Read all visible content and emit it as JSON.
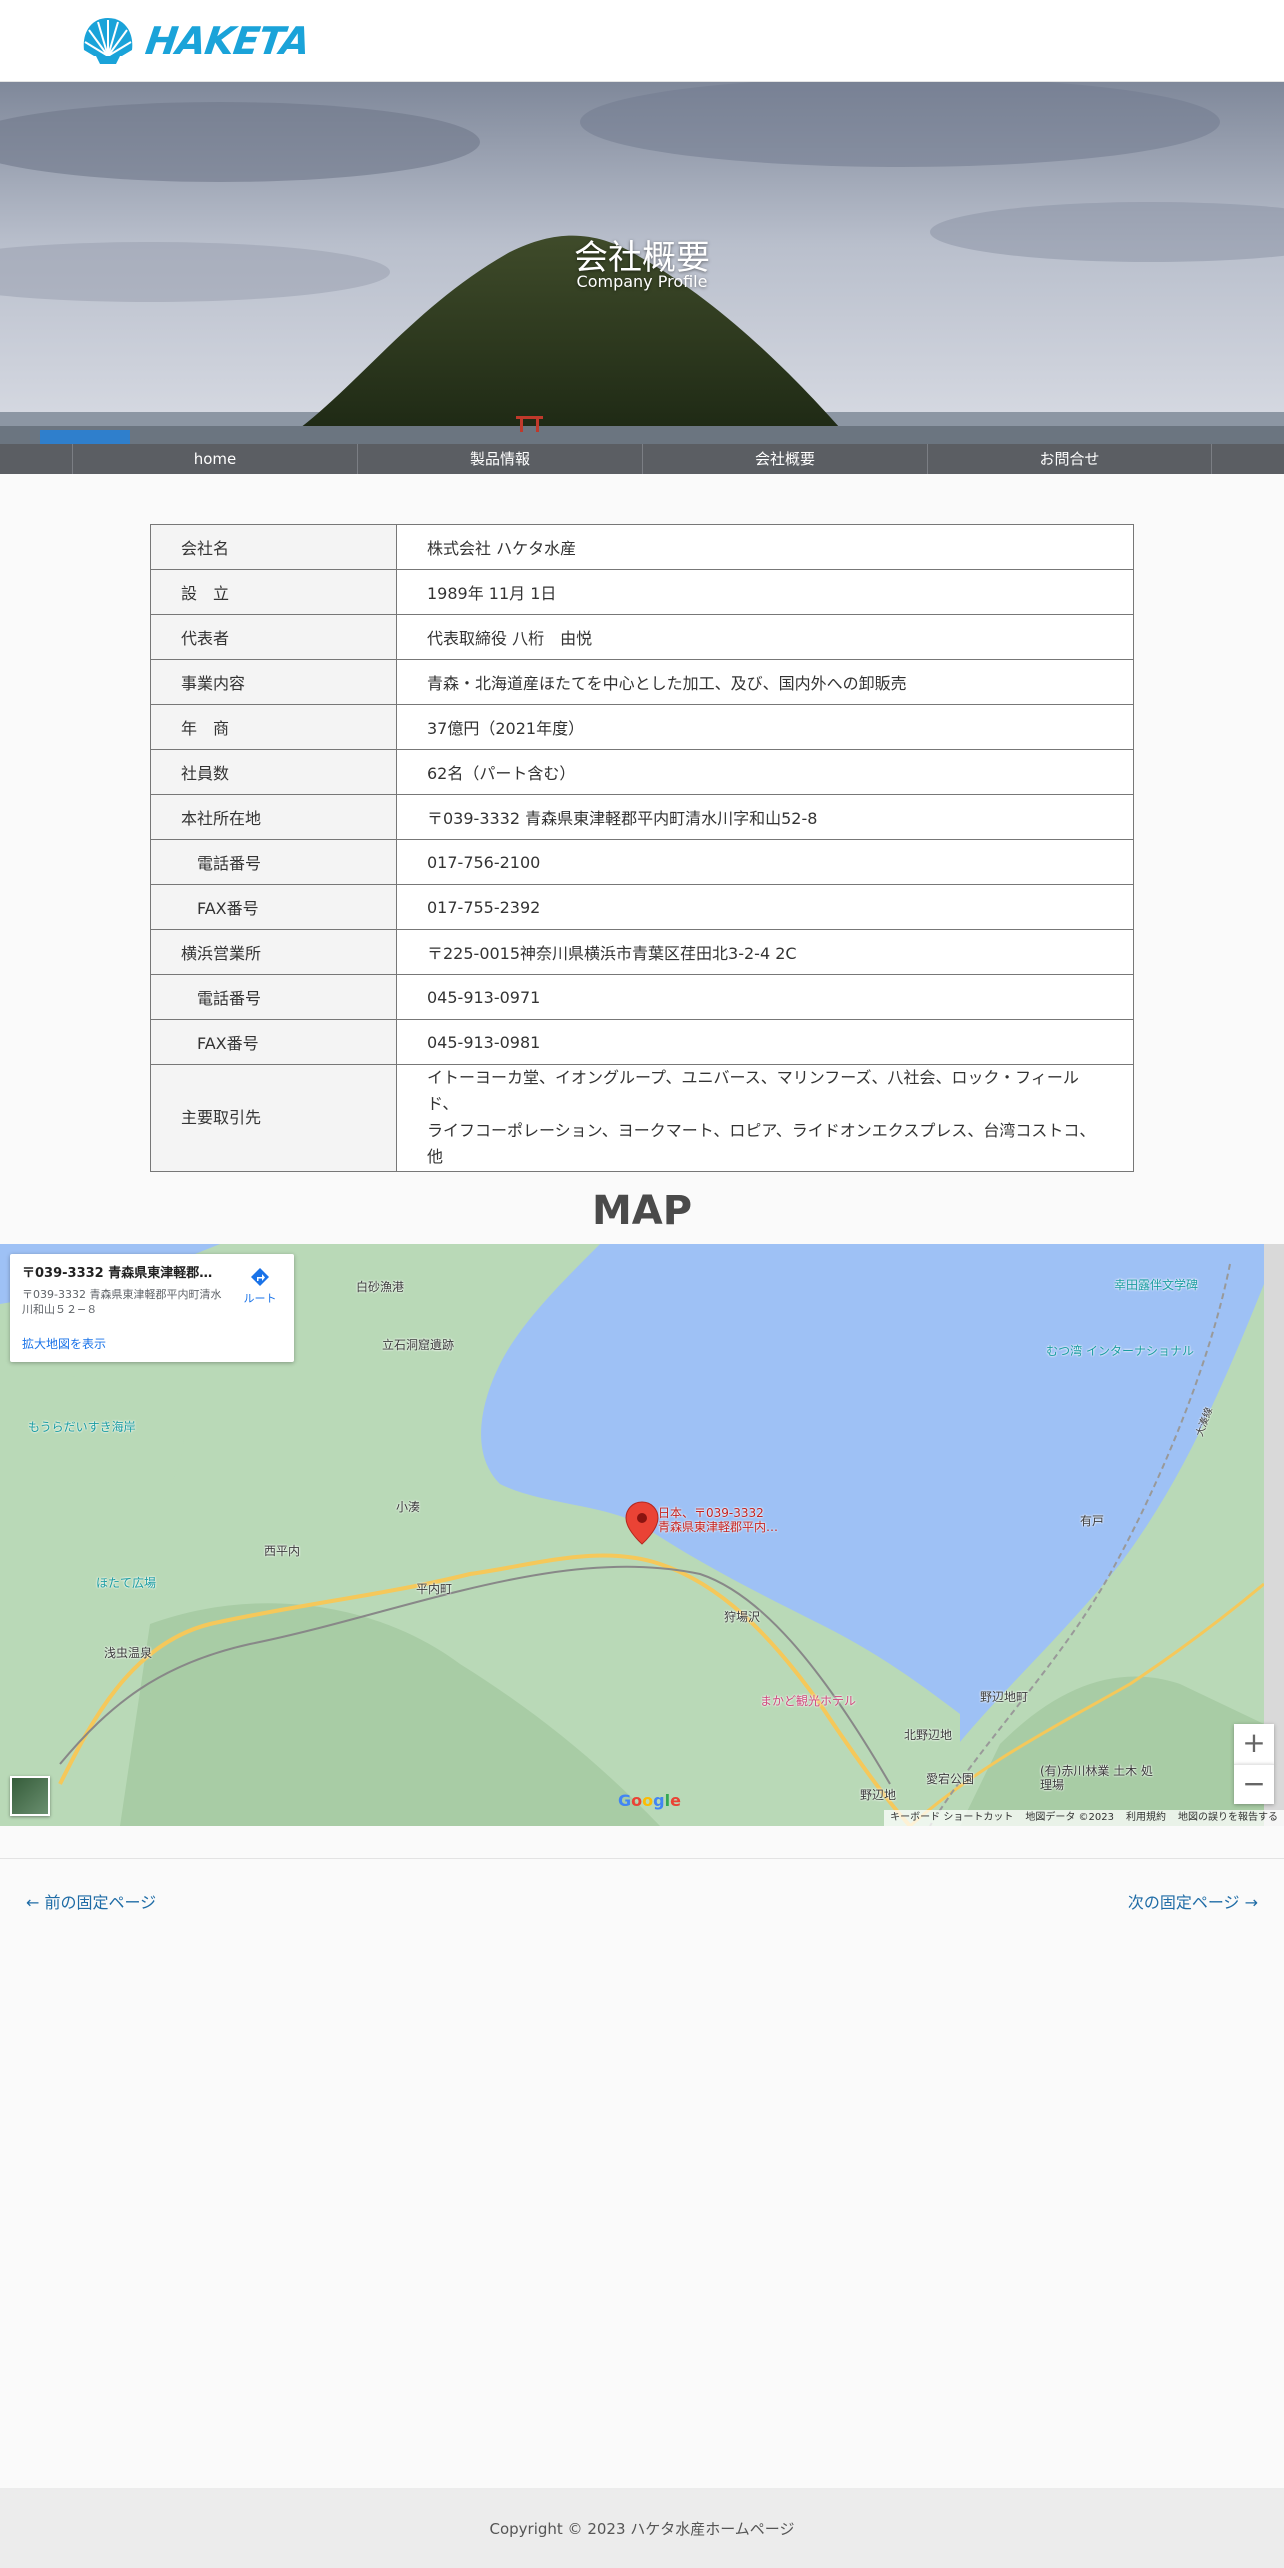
{
  "header": {
    "logo_text": "HAKETA"
  },
  "hero": {
    "title": "会社概要",
    "subtitle": "Company Profile"
  },
  "nav": {
    "items": [
      {
        "label": "home"
      },
      {
        "label": "製品情報"
      },
      {
        "label": "会社概要"
      },
      {
        "label": "お問合せ"
      }
    ]
  },
  "profile": {
    "rows": [
      {
        "label": "会社名",
        "value": "株式会社 ハケタ水産"
      },
      {
        "label": "設　立",
        "value": "1989年 11月 1日"
      },
      {
        "label": "代表者",
        "value": "代表取締役 八桁　由悦"
      },
      {
        "label": "事業内容",
        "value": "青森・北海道産ほたてを中心とした加工、及び、国内外への卸販売"
      },
      {
        "label": "年　商",
        "value": "37億円（2021年度）"
      },
      {
        "label": "社員数",
        "value": "62名（パート含む）"
      },
      {
        "label": "本社所在地",
        "value": "〒039-3332 青森県東津軽郡平内町清水川字和山52-8"
      },
      {
        "label": "電話番号",
        "value": "017-756-2100"
      },
      {
        "label": "FAX番号",
        "value": "017-755-2392"
      },
      {
        "label": "横浜営業所",
        "value": "〒225-0015神奈川県横浜市青葉区荏田北3-2-4 2C"
      },
      {
        "label": "電話番号",
        "value": "045-913-0971"
      },
      {
        "label": "FAX番号",
        "value": "045-913-0981"
      },
      {
        "label": "主要取引先",
        "value_line1": "イトーヨーカ堂、イオングループ、ユニバース、マリンフーズ、八社会、ロック・フィールド、",
        "value_line2": "ライフコーポレーション、ヨークマート、ロピア、ライドオンエクスプレス、台湾コストコ、他"
      }
    ]
  },
  "map_section": {
    "heading": "MAP",
    "card": {
      "title": "〒039-3332 青森県東津軽郡平内町清水川和山５２−８",
      "address": "〒039-3332 青森県東津軽郡平内町清水川和山５２−８",
      "link": "拡大地図を表示",
      "route_label": "ルート"
    },
    "labels": {
      "shirasuna": "白砂漁港",
      "tateishi": "立石洞窟遺跡",
      "moura": "もうらだいすき海岸",
      "kominato": "小湊",
      "nishi_hiranai": "西平内",
      "hiranai": "平内町",
      "hotate": "ほたて広場",
      "asamushi": "浅虫温泉",
      "karibasawa": "狩場沢",
      "makado": "まかど観光ホテル",
      "noheji_town": "野辺地町",
      "kita_noheji": "北野辺地",
      "noheji": "野辺地",
      "atago": "愛宕公園",
      "akagawa": "(有)赤川林業 土木 処理場",
      "koda": "幸田露伴文学碑",
      "mutsu": "むつ湾 インターナショナル",
      "arito": "有戸",
      "pin_line1": "日本、〒039-3332",
      "pin_line2": "青森県東津軽郡平内…",
      "omo": "大湊線"
    },
    "zoom_in": "+",
    "zoom_out": "−",
    "footer": {
      "shortcuts": "キーボード ショートカット",
      "data": "地図データ ©2023",
      "terms": "利用規約",
      "report": "地図の誤りを報告する"
    },
    "google": [
      "G",
      "o",
      "o",
      "g",
      "l",
      "e"
    ]
  },
  "post_nav": {
    "prev": "← 前の固定ページ",
    "next": "次の固定ページ →"
  },
  "footer": {
    "copyright": "Copyright © 2023 ハケタ水産ホームページ"
  },
  "colors": {
    "nav_bg": "#5b5e63",
    "logo_blue": "#1aa3d9",
    "link_blue": "#1f6ca6"
  }
}
